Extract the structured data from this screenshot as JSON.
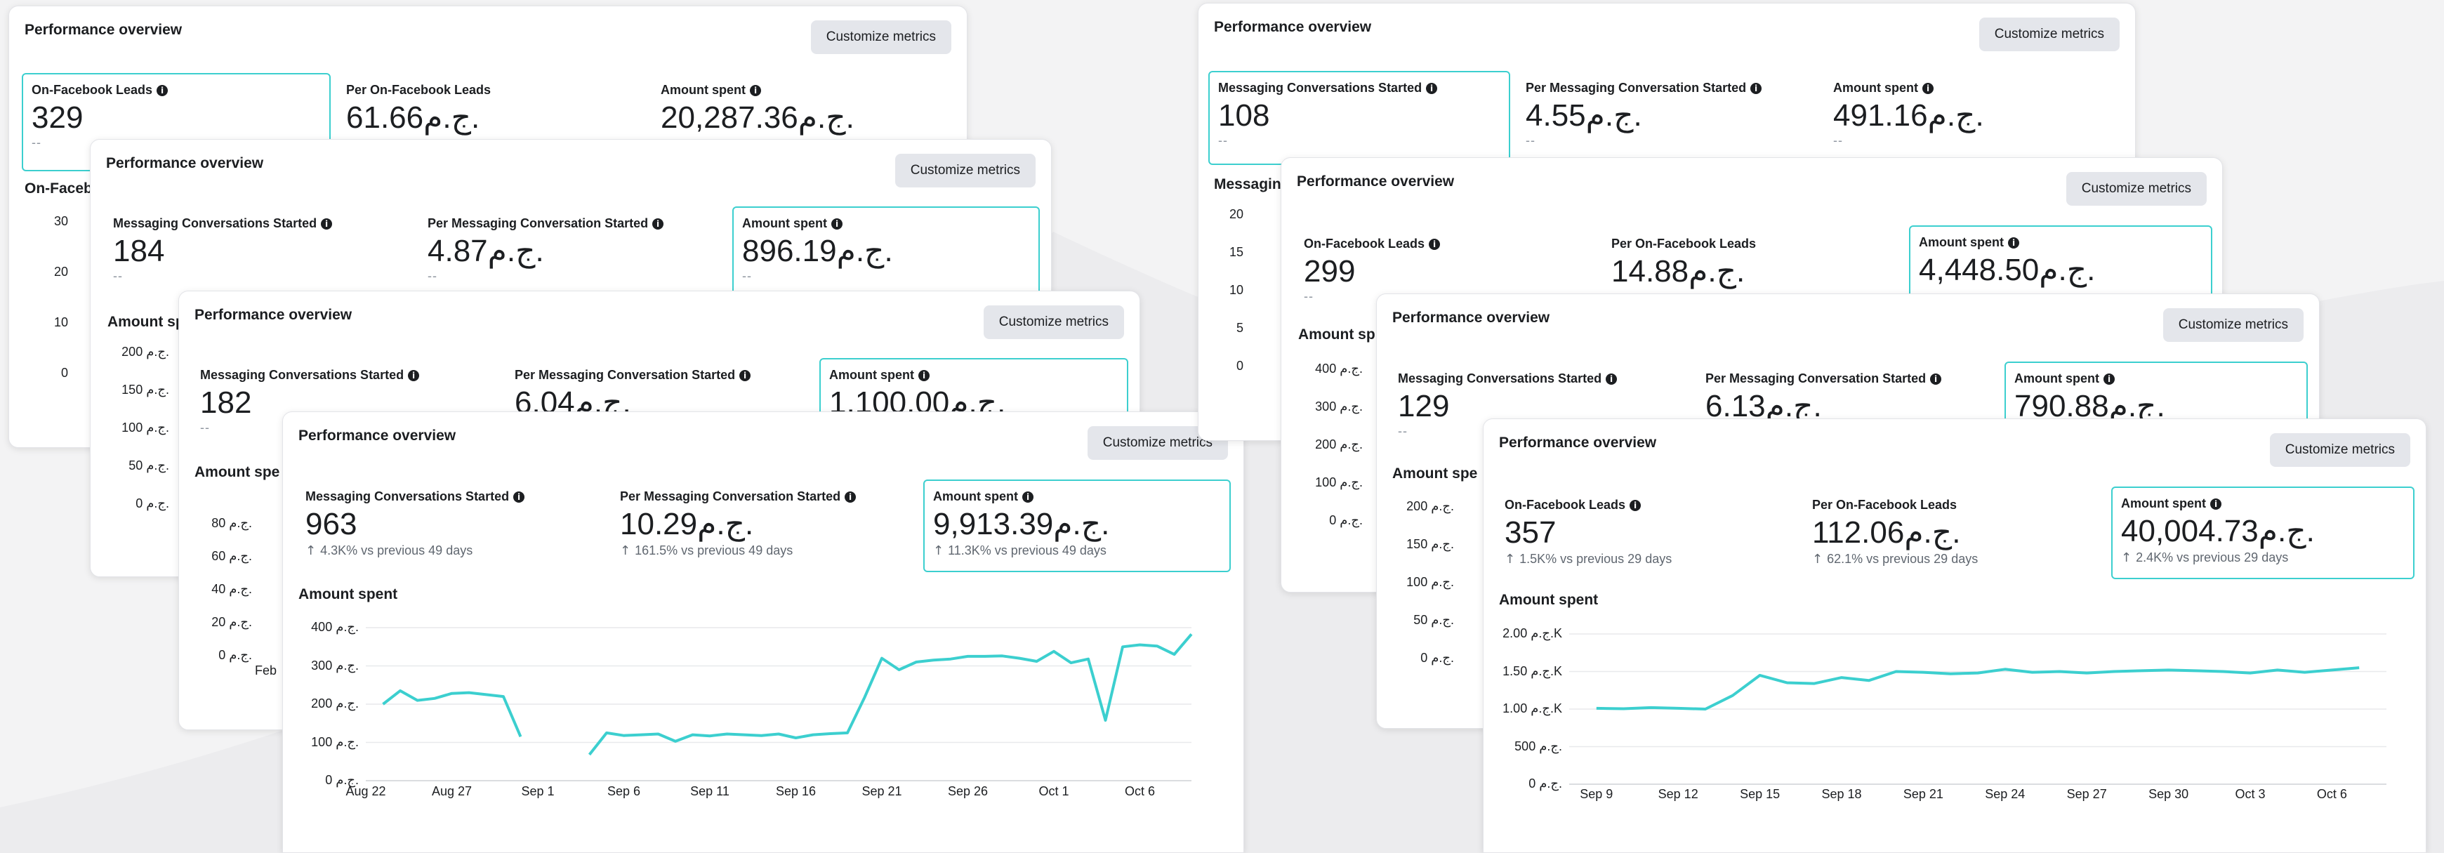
{
  "common": {
    "card_title": "Performance overview",
    "customize_label": "Customize metrics",
    "no_change": "--",
    "amount_spent": "Amount spent",
    "accent_color": "#3ccfcf"
  },
  "left_stack": {
    "card1": {
      "metrics": [
        {
          "label": "On-Facebook Leads",
          "value": "329"
        },
        {
          "label": "Per On-Facebook Leads",
          "value": "61.66ج.م."
        },
        {
          "label": "Amount spent",
          "value": "20,287.36ج.م."
        }
      ],
      "chart_label": "On-Faceb",
      "y_ticks": [
        "30",
        "20",
        "10",
        "0"
      ]
    },
    "card2": {
      "metrics": [
        {
          "label": "Messaging Conversations Started",
          "value": "184"
        },
        {
          "label": "Per Messaging Conversation Started",
          "value": "4.87ج.م."
        },
        {
          "label": "Amount spent",
          "value": "896.19ج.م."
        }
      ],
      "chart_label": "Amount spe",
      "y_ticks": [
        "200 ج.م.",
        "150 ج.م.",
        "100 ج.م.",
        "50 ج.م.",
        "0 ج.م."
      ]
    },
    "card3": {
      "metrics": [
        {
          "label": "Messaging Conversations Started",
          "value": "182"
        },
        {
          "label": "Per Messaging Conversation Started",
          "value": "6.04ج.م."
        },
        {
          "label": "Amount spent",
          "value": "1,100.00ج.م."
        }
      ],
      "chart_label": "Amount spe",
      "y_ticks": [
        "80 ج.م.",
        "60 ج.م.",
        "40 ج.م.",
        "20 ج.م.",
        "0 ج.م."
      ],
      "x_tick": "Feb"
    },
    "card4": {
      "metrics": [
        {
          "label": "Messaging Conversations Started",
          "value": "963",
          "change": "4.3K% vs previous 49 days"
        },
        {
          "label": "Per Messaging Conversation Started",
          "value": "10.29ج.م.",
          "change": "161.5% vs previous 49 days"
        },
        {
          "label": "Amount spent",
          "value": "9,913.39ج.م.",
          "change": "11.3K% vs previous 49 days"
        }
      ],
      "chart_label": "Amount spent"
    }
  },
  "right_stack": {
    "card1": {
      "metrics": [
        {
          "label": "Messaging Conversations Started",
          "value": "108"
        },
        {
          "label": "Per Messaging Conversation Started",
          "value": "4.55ج.م."
        },
        {
          "label": "Amount spent",
          "value": "491.16ج.م."
        }
      ],
      "chart_label": "Messagin",
      "y_ticks": [
        "20",
        "15",
        "10",
        "5",
        "0"
      ]
    },
    "card2": {
      "metrics": [
        {
          "label": "On-Facebook Leads",
          "value": "299"
        },
        {
          "label": "Per On-Facebook Leads",
          "value": "14.88ج.م."
        },
        {
          "label": "Amount spent",
          "value": "4,448.50ج.م."
        }
      ],
      "chart_label": "Amount sp",
      "y_ticks": [
        "400 ج.م.",
        "300 ج.م.",
        "200 ج.م.",
        "100 ج.م.",
        "0 ج.م."
      ]
    },
    "card3": {
      "metrics": [
        {
          "label": "Messaging Conversations Started",
          "value": "129"
        },
        {
          "label": "Per Messaging Conversation Started",
          "value": "6.13ج.م."
        },
        {
          "label": "Amount spent",
          "value": "790.88ج.م."
        }
      ],
      "chart_label": "Amount spe",
      "y_ticks": [
        "200 ج.م.",
        "150 ج.م.",
        "100 ج.م.",
        "50 ج.م.",
        "0 ج.م."
      ]
    },
    "card4": {
      "metrics": [
        {
          "label": "On-Facebook Leads",
          "value": "357",
          "change": "1.5K% vs previous 29 days"
        },
        {
          "label": "Per On-Facebook Leads",
          "value": "112.06ج.م.",
          "change": "62.1% vs previous 29 days"
        },
        {
          "label": "Amount spent",
          "value": "40,004.73ج.م.",
          "change": "2.4K% vs previous 29 days"
        }
      ],
      "chart_label": "Amount spent"
    }
  },
  "chart_data": [
    {
      "type": "line",
      "ylabel": "Amount spent",
      "y_ticks": [
        "400 ج.م.",
        "300 ج.م.",
        "200 ج.م.",
        "100 ج.م.",
        "0 ج.م."
      ],
      "ylim": [
        0,
        400
      ],
      "x_ticks": [
        "Aug 22",
        "Aug 27",
        "Sep 1",
        "Sep 6",
        "Sep 11",
        "Sep 16",
        "Sep 21",
        "Sep 26",
        "Oct 1",
        "Oct 6"
      ],
      "x_tick_index": [
        0,
        5,
        10,
        15,
        20,
        25,
        30,
        35,
        40,
        45
      ],
      "grid": true,
      "series": [
        {
          "color": "#3ccfcf",
          "segments": [
            {
              "start_index": 1,
              "values": [
                200,
                235,
                210,
                215,
                228,
                230,
                225,
                220,
                115
              ]
            },
            {
              "start_index": 13,
              "values": [
                68,
                125,
                118,
                120,
                122,
                103,
                120,
                117,
                122,
                120,
                118,
                122,
                112,
                120,
                123,
                125,
                218,
                320,
                290,
                310,
                315,
                318,
                325,
                325,
                326,
                320,
                312,
                338,
                308,
                318,
                158,
                350,
                355,
                352,
                330,
                383
              ]
            }
          ]
        }
      ]
    },
    {
      "type": "line",
      "ylabel": "Amount spent",
      "y_ticks": [
        "2.00 ج.م.K",
        "1.50 ج.م.K",
        "1.00 ج.م.K",
        "500 ج.م.",
        "0 ج.م."
      ],
      "ylim": [
        0,
        2000
      ],
      "x_ticks": [
        "Sep 9",
        "Sep 12",
        "Sep 15",
        "Sep 18",
        "Sep 21",
        "Sep 24",
        "Sep 27",
        "Sep 30",
        "Oct 3",
        "Oct 6"
      ],
      "x_tick_index": [
        1,
        4,
        7,
        10,
        13,
        16,
        19,
        22,
        25,
        28
      ],
      "grid": true,
      "series": [
        {
          "color": "#3ccfcf",
          "segments": [
            {
              "start_index": 1,
              "values": [
                1010,
                1005,
                1020,
                1010,
                1000,
                1180,
                1450,
                1350,
                1340,
                1420,
                1380,
                1500,
                1490,
                1470,
                1480,
                1530,
                1490,
                1500,
                1480,
                1500,
                1510,
                1520,
                1510,
                1500,
                1480,
                1520,
                1490,
                1520,
                1550
              ]
            }
          ]
        }
      ]
    }
  ]
}
